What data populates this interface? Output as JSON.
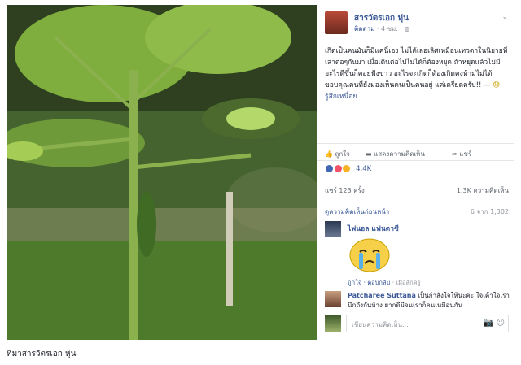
{
  "post": {
    "author": "สารวัตรเอก หุ่น",
    "follow": "ติดตาม",
    "time": "· 4 ชม. ·",
    "text": "เกิดเป็นคนมันก็มีแค่นี้เอง ไม่ได้เลอเลิศเหมือนเทวดาในนิยายที่เล่าต่อๆกันมา เมื่อเดินต่อไปไม่ได้ก็ต้องหยุด ถ้าหยุดแล้วไม่มีอะไรดีขึ้นก็คอยฟังข่าว อะไรจะเกิดก็ต้องเกิดคงห้ามไม่ได้ ขอบคุณคนที่ยังมองเห็นคนเป็นคนอยู่ แค่เครียดครับ!! —",
    "feeling": "รู้สึกเหนื่อย"
  },
  "actions": {
    "like": "ถูกใจ",
    "comment": "แสดงความคิดเห็น",
    "share": "แชร์"
  },
  "stats": {
    "reaction_count": "4.4K",
    "shares": "แชร์ 123 ครั้ง",
    "comments": "1.3K ความคิดเห็น"
  },
  "comments": {
    "view_more": "ดูความคิดเห็นก่อนหน้า",
    "pager": "6 จาก 1,302",
    "c1_name": "ไฟนอล แฟนตาซี",
    "c1_like": "ถูกใจ",
    "c1_reply": "ตอบกลับ",
    "c1_time": "· เมื่อสักครู่",
    "c2_name": "Patcharee Suttana",
    "c2_text": "เป็นกำลังใจให้นะค่ะ ใจเค้าใจเรา นึกถึงกันบ้าง ยากดีมีจนเราก็คนเหมือนกัน"
  },
  "input": {
    "placeholder": "เขียนความคิดเห็น..."
  },
  "caption": "ที่มาสารวัตรเอก หุ่น"
}
